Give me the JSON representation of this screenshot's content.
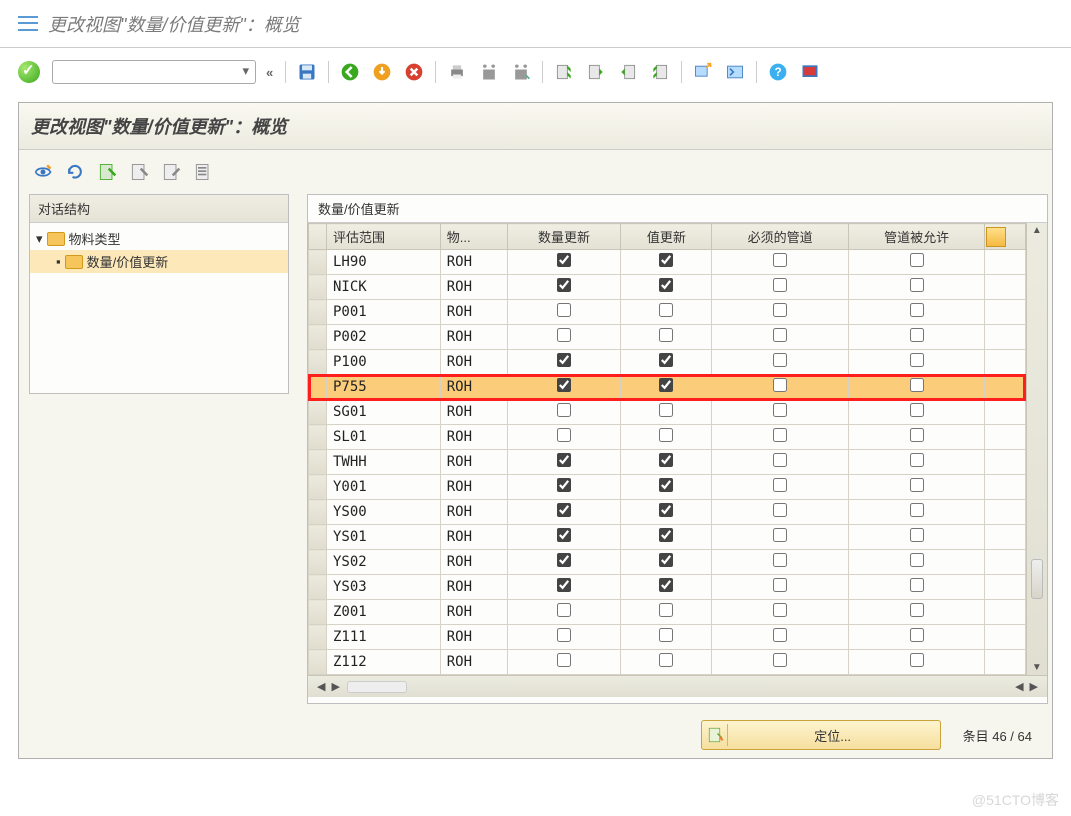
{
  "header": {
    "window_title": "更改视图\"数量/价值更新\"：概览",
    "panel_title": "更改视图\"数量/价值更新\"：概览"
  },
  "tree": {
    "header": "对话结构",
    "root_label": "物料类型",
    "child_label": "数量/价值更新"
  },
  "table": {
    "caption": "数量/价值更新",
    "columns": {
      "val_area": "评估范围",
      "mat": "物...",
      "qty_update": "数量更新",
      "val_update": "值更新",
      "pipe_req": "必须的管道",
      "pipe_allowed": "管道被允许"
    },
    "rows": [
      {
        "va": "LH90",
        "mt": "ROH",
        "qu": true,
        "vu": true,
        "pr": false,
        "pa": false,
        "hl": false
      },
      {
        "va": "NICK",
        "mt": "ROH",
        "qu": true,
        "vu": true,
        "pr": false,
        "pa": false,
        "hl": false
      },
      {
        "va": "P001",
        "mt": "ROH",
        "qu": false,
        "vu": false,
        "pr": false,
        "pa": false,
        "hl": false
      },
      {
        "va": "P002",
        "mt": "ROH",
        "qu": false,
        "vu": false,
        "pr": false,
        "pa": false,
        "hl": false
      },
      {
        "va": "P100",
        "mt": "ROH",
        "qu": true,
        "vu": true,
        "pr": false,
        "pa": false,
        "hl": false
      },
      {
        "va": "P755",
        "mt": "ROH",
        "qu": true,
        "vu": true,
        "pr": false,
        "pa": false,
        "hl": true
      },
      {
        "va": "SG01",
        "mt": "ROH",
        "qu": false,
        "vu": false,
        "pr": false,
        "pa": false,
        "hl": false
      },
      {
        "va": "SL01",
        "mt": "ROH",
        "qu": false,
        "vu": false,
        "pr": false,
        "pa": false,
        "hl": false
      },
      {
        "va": "TWHH",
        "mt": "ROH",
        "qu": true,
        "vu": true,
        "pr": false,
        "pa": false,
        "hl": false
      },
      {
        "va": "Y001",
        "mt": "ROH",
        "qu": true,
        "vu": true,
        "pr": false,
        "pa": false,
        "hl": false
      },
      {
        "va": "YS00",
        "mt": "ROH",
        "qu": true,
        "vu": true,
        "pr": false,
        "pa": false,
        "hl": false
      },
      {
        "va": "YS01",
        "mt": "ROH",
        "qu": true,
        "vu": true,
        "pr": false,
        "pa": false,
        "hl": false
      },
      {
        "va": "YS02",
        "mt": "ROH",
        "qu": true,
        "vu": true,
        "pr": false,
        "pa": false,
        "hl": false
      },
      {
        "va": "YS03",
        "mt": "ROH",
        "qu": true,
        "vu": true,
        "pr": false,
        "pa": false,
        "hl": false
      },
      {
        "va": "Z001",
        "mt": "ROH",
        "qu": false,
        "vu": false,
        "pr": false,
        "pa": false,
        "hl": false
      },
      {
        "va": "Z111",
        "mt": "ROH",
        "qu": false,
        "vu": false,
        "pr": false,
        "pa": false,
        "hl": false
      },
      {
        "va": "Z112",
        "mt": "ROH",
        "qu": false,
        "vu": false,
        "pr": false,
        "pa": false,
        "hl": false
      }
    ]
  },
  "footer": {
    "locate_label": "定位...",
    "status": "条目 46 / 64"
  },
  "watermark": "@51CTO博客"
}
